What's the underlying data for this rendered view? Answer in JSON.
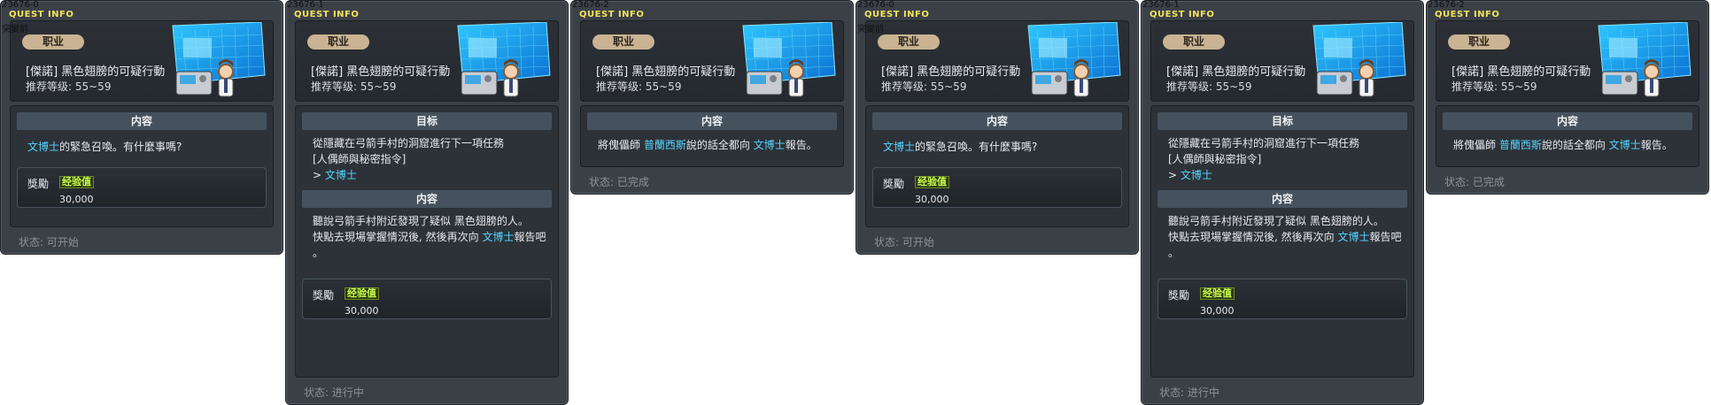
{
  "panels": [
    {
      "id": "23676-0",
      "title": "QUEST INFO",
      "subtitle": "突變前",
      "job_badge": "职业",
      "quest_name": "[傑諾] 黑色翅膀的可疑行動",
      "level": "推荐等级: 55~59",
      "goal_header": "",
      "goal_lines": [],
      "content_header": "内容",
      "content_lines": [
        [
          "文博士",
          "的緊急召喚。有什麼事嗎?"
        ]
      ],
      "reward_label": "獎勵",
      "exp_label": "经验值",
      "reward_value": "30,000",
      "status": "状态:  可开始"
    },
    {
      "id": "23676-1",
      "title": "QUEST INFO",
      "subtitle": "",
      "job_badge": "职业",
      "quest_name": "[傑諾] 黑色翅膀的可疑行動",
      "level": "推荐等级: 55~59",
      "goal_header": "目标",
      "goal_lines": [
        "從隱藏在弓箭手村的洞窟進行下一項任務",
        "[人偶師與秘密指令]",
        "> 文博士"
      ],
      "content_header": "内容",
      "content_lines": [
        "聽說弓箭手村附近發現了疑似 黑色翅膀的人。",
        "快點去現場掌握情況後, 然後再次向 文博士報告吧",
        "。"
      ],
      "reward_label": "獎勵",
      "exp_label": "经验值",
      "reward_value": "30,000",
      "status": "状态:  进行中"
    },
    {
      "id": "23676-2",
      "title": "QUEST INFO",
      "subtitle": "",
      "job_badge": "职业",
      "quest_name": "[傑諾] 黑色翅膀的可疑行動",
      "level": "推荐等级: 55~59",
      "content_header": "内容",
      "content_line": "將傀儡師 普蘭西斯說的話全都向 文博士報告。",
      "status": "状态:  已完成"
    }
  ],
  "colors": {
    "highlight": "#56d4ff",
    "title": "#f3e35a",
    "panel_bg": "#3b4047"
  }
}
